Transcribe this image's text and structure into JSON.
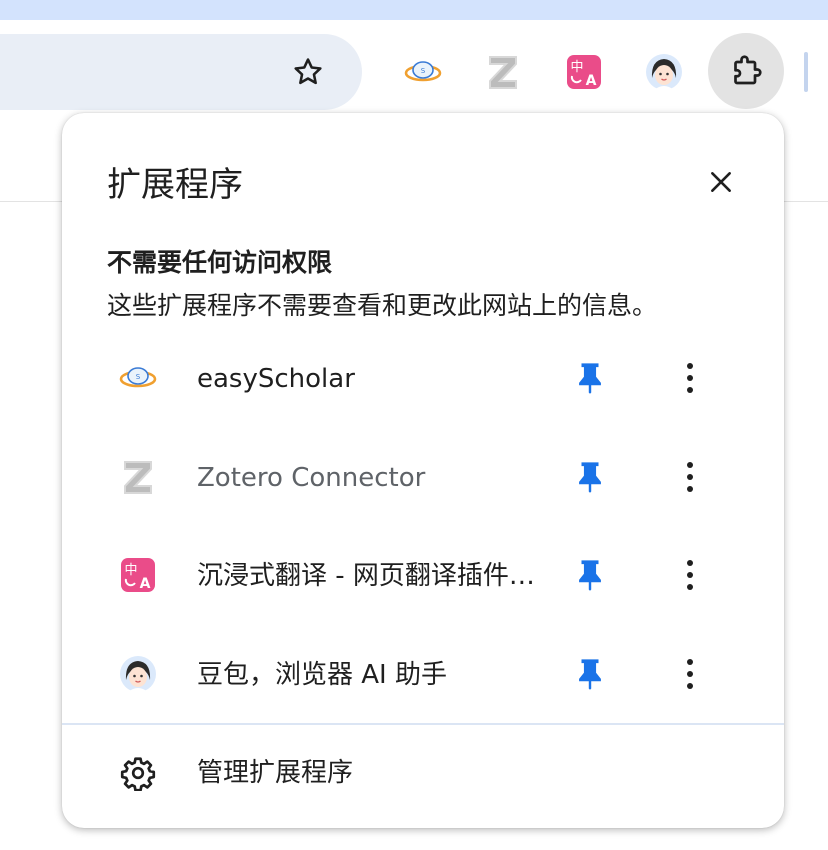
{
  "colors": {
    "accent": "#1a73e8",
    "toolbar_bg": "#d3e3fd",
    "omnibox_bg": "#e9eef6",
    "text_primary": "#1f1f1f",
    "text_secondary": "#5f6368"
  },
  "toolbar": {
    "bookmark_icon": "star-icon",
    "pinned_icons": [
      "easyscholar-icon",
      "zotero-icon",
      "immersive-translate-icon",
      "doubao-icon"
    ],
    "extensions_icon": "puzzle-icon"
  },
  "popup": {
    "title": "扩展程序",
    "close_icon": "close-icon",
    "section_heading": "不需要任何访问权限",
    "section_desc": "这些扩展程序不需要查看和更改此网站上的信息。",
    "extensions": [
      {
        "name": "easyScholar",
        "icon": "easyscholar-icon",
        "pinned": true
      },
      {
        "name": "Zotero Connector",
        "icon": "zotero-icon",
        "pinned": true
      },
      {
        "name": "沉浸式翻译 - 网页翻译插件 | PDF 翻译",
        "icon": "immersive-translate-icon",
        "pinned": true
      },
      {
        "name": "豆包，浏览器 AI 助手",
        "icon": "doubao-icon",
        "pinned": true
      }
    ],
    "manage_label": "管理扩展程序",
    "manage_icon": "gear-icon"
  }
}
